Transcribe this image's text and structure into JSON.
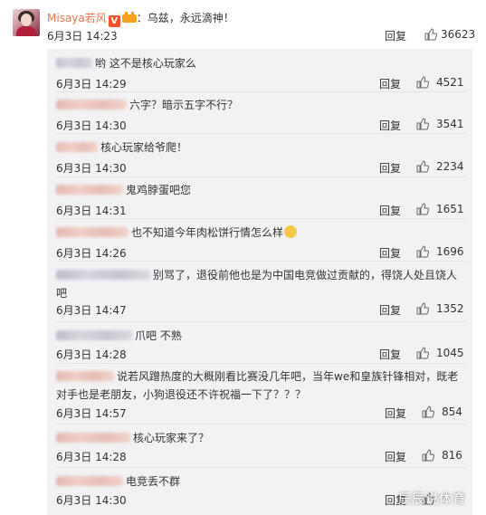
{
  "main_comment": {
    "username": "Misaya若风",
    "verified_badge": "V",
    "separator": "：",
    "text": "乌兹，永远滴神！",
    "time": "6月3日 14:23",
    "reply_label": "回复",
    "likes": "36623"
  },
  "replies": [
    {
      "text": "哟 这不是核心玩家么",
      "time": "6月3日 14:29",
      "reply_label": "回复",
      "likes": "4521"
    },
    {
      "text": "六字？暗示五字不行？",
      "time": "6月3日 14:30",
      "reply_label": "回复",
      "likes": "3541"
    },
    {
      "text": "核心玩家给爷爬！",
      "time": "6月3日 14:30",
      "reply_label": "回复",
      "likes": "2234"
    },
    {
      "text": "鬼鸡脖蛋吧您",
      "time": "6月3日 14:31",
      "reply_label": "回复",
      "likes": "1651"
    },
    {
      "text": "也不知道今年肉松饼行情怎么样",
      "time": "6月3日 14:26",
      "reply_label": "回复",
      "likes": "1696"
    },
    {
      "text": "别骂了，退役前他也是为中国电竞做过贡献的，得饶人处且饶人吧",
      "time": "6月3日 14:47",
      "reply_label": "回复",
      "likes": "1352"
    },
    {
      "text": "爪吧 不熟",
      "time": "6月3日 14:28",
      "reply_label": "回复",
      "likes": "1045"
    },
    {
      "text": "说若风蹭热度的大概刚看比赛没几年吧，当年we和皇族针锋相对，既老对手也是老朋友，小狗退役还不许祝福一下了？？？",
      "time": "6月3日 14:57",
      "reply_label": "回复",
      "likes": "854"
    },
    {
      "text": "核心玩家来了？",
      "time": "6月3日 14:28",
      "reply_label": "回复",
      "likes": "816"
    },
    {
      "text": "电竞丢不群",
      "time": "6月3日 14:30",
      "reply_label": "回复",
      "likes": ""
    }
  ],
  "watermark": "辰辰说体育",
  "colors": {
    "username": "#eb7350",
    "reply_bg": "#f2f2f5",
    "badge": "#f5532a"
  },
  "icons": {
    "like": "thumbs-up-icon",
    "verified": "verified-badge-icon",
    "vip": "crown-icon"
  }
}
